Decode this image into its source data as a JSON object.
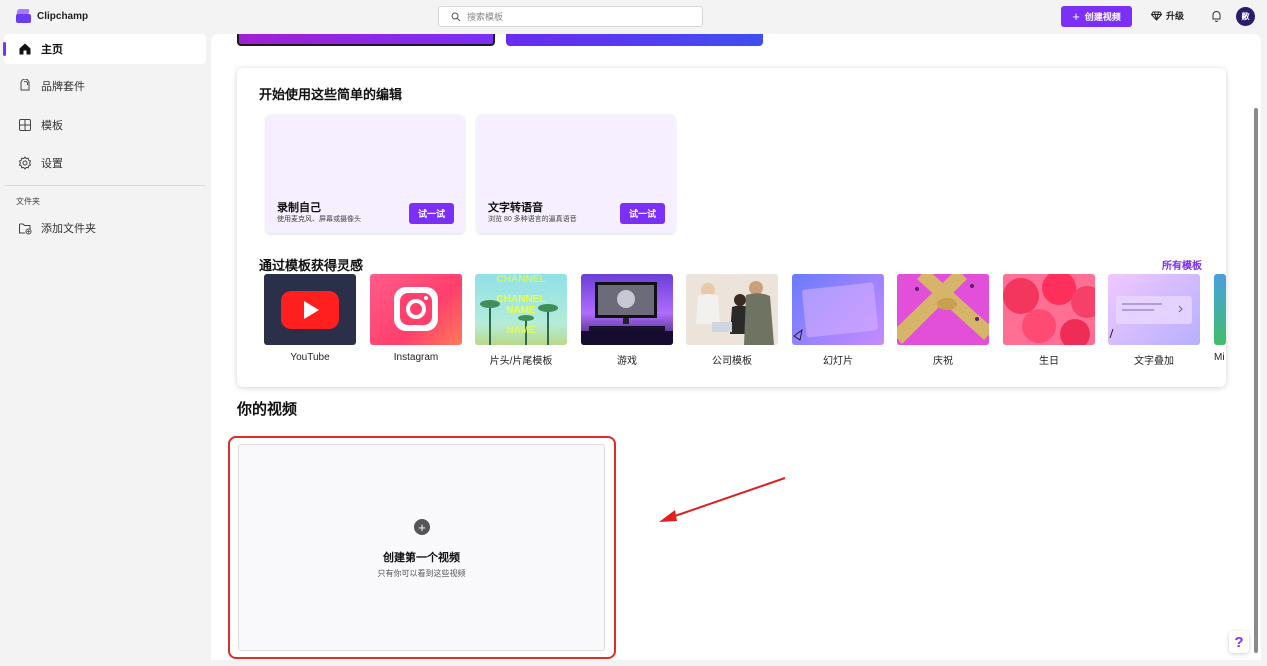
{
  "app": {
    "name": "Clipchamp"
  },
  "topbar": {
    "search_placeholder": "搜索模板",
    "create_label": "创建视频",
    "upgrade_label": "升级",
    "avatar_text": "敝"
  },
  "sidebar": {
    "items": [
      {
        "label": "主页",
        "icon": "home-icon"
      },
      {
        "label": "品牌套件",
        "icon": "brand-kit-icon"
      },
      {
        "label": "模板",
        "icon": "templates-icon"
      },
      {
        "label": "设置",
        "icon": "gear-icon"
      }
    ],
    "folder_section_label": "文件夹",
    "add_folder_label": "添加文件夹"
  },
  "easy_edits": {
    "title": "开始使用这些简单的编辑",
    "cards": [
      {
        "title": "录制自己",
        "desc": "使用麦克风、屏幕或摄像头",
        "button": "试一试"
      },
      {
        "title": "文字转语音",
        "desc": "浏览 80 多种语言的逼真语音",
        "button": "试一试"
      }
    ]
  },
  "templates": {
    "title": "通过模板获得灵感",
    "all_link": "所有模板",
    "items": [
      {
        "label": "YouTube"
      },
      {
        "label": "Instagram"
      },
      {
        "label": "片头/片尾模板"
      },
      {
        "label": "游戏"
      },
      {
        "label": "公司模板"
      },
      {
        "label": "幻灯片"
      },
      {
        "label": "庆祝"
      },
      {
        "label": "生日"
      },
      {
        "label": "文字叠加"
      },
      {
        "label": "Mi"
      }
    ],
    "intro_thumb_text": [
      "CHANNEL",
      "CHANNEL",
      "NAME",
      "NAME"
    ]
  },
  "videos": {
    "title": "你的视频",
    "create_first_title": "创建第一个视频",
    "create_first_sub": "只有你可以看到这些视频"
  },
  "help_label": "?",
  "colors": {
    "accent": "#7b2ff7",
    "highlight": "#e32a2a"
  }
}
